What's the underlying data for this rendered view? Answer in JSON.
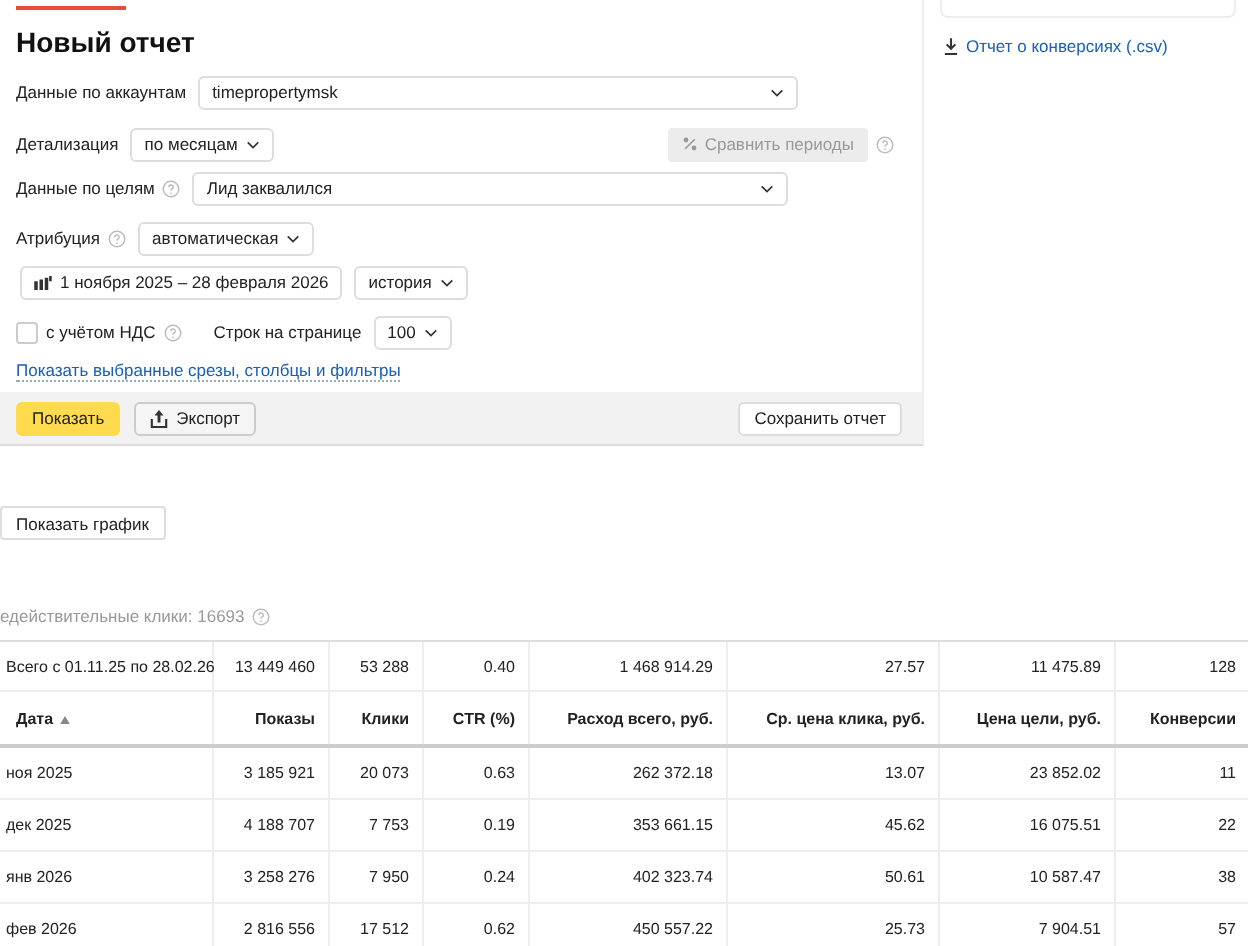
{
  "title": "Новый отчет",
  "accounts": {
    "label": "Данные по аккаунтам",
    "value": "timepropertymsk"
  },
  "detail": {
    "label": "Детализация",
    "value": "по месяцам"
  },
  "compare": {
    "label": "Сравнить периоды",
    "disabled": true
  },
  "goals": {
    "label": "Данные по целям",
    "value": "Лид заквалился"
  },
  "attribution": {
    "label": "Атрибуция",
    "value": "автоматическая"
  },
  "period": {
    "value": "1 ноября 2025 – 28 февраля 2026",
    "mode": "история"
  },
  "vat": {
    "label": "с учётом НДС",
    "checked": false
  },
  "rows_per_page": {
    "label": "Строк на странице",
    "value": "100"
  },
  "filters_link": "Показать выбранные срезы, столбцы и фильтры",
  "buttons": {
    "show": "Показать",
    "export": "Экспорт",
    "save": "Сохранить отчет"
  },
  "csv_link": "Отчет о конверсиях (.csv)",
  "chart_button": "Показать график",
  "invalid_clicks": "едействительные клики: 16693",
  "table": {
    "total": [
      "Всего с 01.11.25 по 28.02.26",
      "13 449 460",
      "53 288",
      "0.40",
      "1 468 914.29",
      "27.57",
      "11 475.89",
      "128"
    ],
    "columns": [
      {
        "label": "Дата",
        "sorted": true
      },
      {
        "label": "Показы",
        "sorted": false
      },
      {
        "label": "Клики",
        "sorted": false
      },
      {
        "label": "CTR (%)",
        "sorted": false
      },
      {
        "label": "Расход всего, руб.",
        "sorted": false
      },
      {
        "label": "Ср. цена клика, руб.",
        "sorted": false
      },
      {
        "label": "Цена цели, руб.",
        "sorted": false
      },
      {
        "label": "Конверсии",
        "sorted": false
      }
    ],
    "rows": [
      [
        "ноя 2025",
        "3 185 921",
        "20 073",
        "0.63",
        "262 372.18",
        "13.07",
        "23 852.02",
        "11"
      ],
      [
        "дек 2025",
        "4 188 707",
        "7 753",
        "0.19",
        "353 661.15",
        "45.62",
        "16 075.51",
        "22"
      ],
      [
        "янв 2026",
        "3 258 276",
        "7 950",
        "0.24",
        "402 323.74",
        "50.61",
        "10 587.47",
        "38"
      ],
      [
        "фев 2026",
        "2 816 556",
        "17 512",
        "0.62",
        "450 557.22",
        "25.73",
        "7 904.51",
        "57"
      ]
    ]
  }
}
